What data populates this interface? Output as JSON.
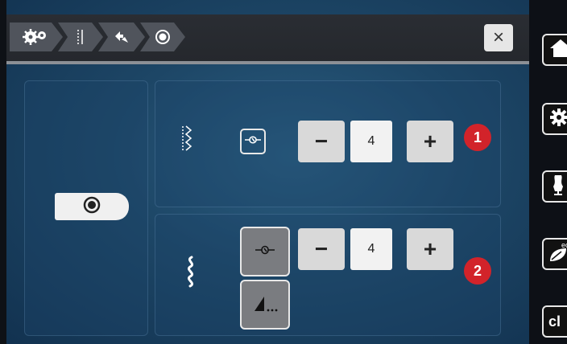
{
  "titlebar": {
    "breadcrumb": [
      {
        "icon": "gears-icon"
      },
      {
        "icon": "stitch-length-icon"
      },
      {
        "icon": "needle-arrow-icon"
      },
      {
        "icon": "target-icon"
      }
    ],
    "close_label": "×"
  },
  "left_panel": {
    "toggle_icon": "circle-target-icon"
  },
  "upper_row": {
    "stitch_icon": "straight-zigzag-stitch-icon",
    "tie_icon": "securing-knot-icon",
    "minus_label": "−",
    "value": "4",
    "plus_label": "+",
    "badge": "1"
  },
  "lower_row": {
    "stitch_icon": "wave-stitch-icon",
    "tie_icon": "securing-knot-icon",
    "minus_label": "−",
    "value": "4",
    "plus_label": "+",
    "badge": "2",
    "extra_icon": "triangle-dots-icon"
  },
  "sidebar": {
    "items": [
      {
        "icon": "home-icon"
      },
      {
        "icon": "gear-icon"
      },
      {
        "icon": "dress-form-icon"
      },
      {
        "icon": "eco-leaf-icon",
        "label": "ec"
      },
      {
        "icon": "clear-icon",
        "label": "cl"
      }
    ]
  },
  "colors": {
    "badge": "#d2232a",
    "background": "#1d4666",
    "button": "#d9d9d9"
  }
}
